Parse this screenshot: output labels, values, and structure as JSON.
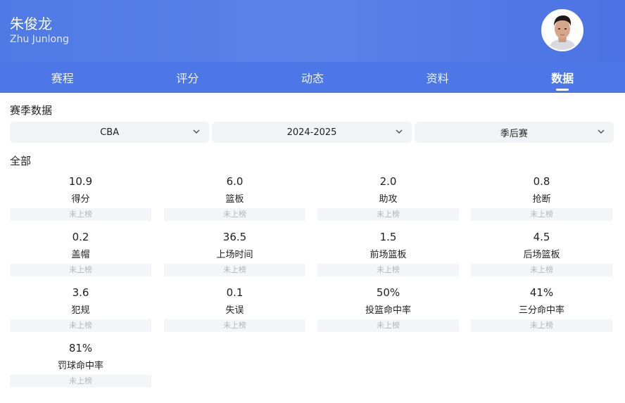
{
  "player": {
    "name": "朱俊龙",
    "name_en": "Zhu Junlong"
  },
  "tabs": [
    {
      "label": "赛程",
      "active": false
    },
    {
      "label": "评分",
      "active": false
    },
    {
      "label": "动态",
      "active": false
    },
    {
      "label": "资料",
      "active": false
    },
    {
      "label": "数据",
      "active": true
    }
  ],
  "season_section": {
    "title": "赛季数据"
  },
  "filters": {
    "league": "CBA",
    "season": "2024-2025",
    "stage": "季后赛"
  },
  "stats_section": {
    "title": "全部"
  },
  "stats": [
    {
      "value": "10.9",
      "label": "得分",
      "rank": "未上榜"
    },
    {
      "value": "6.0",
      "label": "篮板",
      "rank": "未上榜"
    },
    {
      "value": "2.0",
      "label": "助攻",
      "rank": "未上榜"
    },
    {
      "value": "0.8",
      "label": "抢断",
      "rank": "未上榜"
    },
    {
      "value": "0.2",
      "label": "盖帽",
      "rank": "未上榜"
    },
    {
      "value": "36.5",
      "label": "上场时间",
      "rank": "未上榜"
    },
    {
      "value": "1.5",
      "label": "前场篮板",
      "rank": "未上榜"
    },
    {
      "value": "4.5",
      "label": "后场篮板",
      "rank": "未上榜"
    },
    {
      "value": "3.6",
      "label": "犯规",
      "rank": "未上榜"
    },
    {
      "value": "0.1",
      "label": "失误",
      "rank": "未上榜"
    },
    {
      "value": "50%",
      "label": "投篮命中率",
      "rank": "未上榜"
    },
    {
      "value": "41%",
      "label": "三分命中率",
      "rank": "未上榜"
    },
    {
      "value": "81%",
      "label": "罚球命中率",
      "rank": "未上榜"
    }
  ],
  "colors": {
    "header": "#4f79e4",
    "tabs": "#4d77e6",
    "filter_bg": "#f2f3f6",
    "rank_bg": "#f4f5f8",
    "rank_text": "#b3b6bd"
  },
  "icons": {
    "avatar": "player-avatar",
    "dropdown": "chevron-down-icon"
  }
}
